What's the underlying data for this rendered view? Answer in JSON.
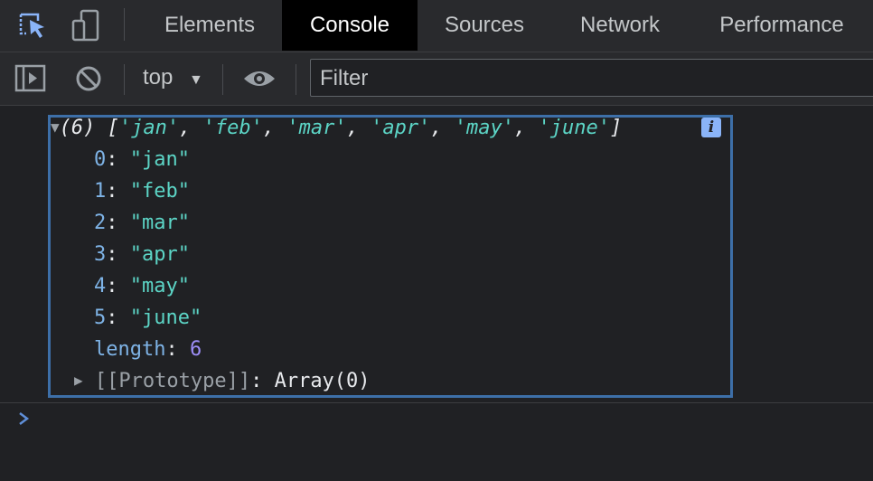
{
  "tabs": [
    {
      "label": "Elements",
      "active": false
    },
    {
      "label": "Console",
      "active": true
    },
    {
      "label": "Sources",
      "active": false
    },
    {
      "label": "Network",
      "active": false
    },
    {
      "label": "Performance",
      "active": false
    }
  ],
  "icons": {
    "inspect": "cursor-select-icon",
    "device": "device-toolbar-icon",
    "sidebar": "sidebar-toggle-icon",
    "clear": "clear-console-icon",
    "eye": "live-expression-icon"
  },
  "toolbar": {
    "context": "top",
    "filter_placeholder": "Filter"
  },
  "console": {
    "summary_prefix": "(6) [",
    "summary_items": [
      "'jan'",
      "'feb'",
      "'mar'",
      "'apr'",
      "'may'",
      "'june'"
    ],
    "summary_suffix": "]",
    "info_badge": "i",
    "entries": [
      {
        "key": "0",
        "value": "\"jan\""
      },
      {
        "key": "1",
        "value": "\"feb\""
      },
      {
        "key": "2",
        "value": "\"mar\""
      },
      {
        "key": "3",
        "value": "\"apr\""
      },
      {
        "key": "4",
        "value": "\"may\""
      },
      {
        "key": "5",
        "value": "\"june\""
      }
    ],
    "length_key": "length",
    "length_value": "6",
    "prototype_key": "[[Prototype]]",
    "prototype_value": "Array(0)"
  },
  "colors": {
    "accent_border": "#3d6fa8",
    "string": "#5cd5c6",
    "key": "#7eb3e6",
    "number": "#9d8ef7"
  }
}
